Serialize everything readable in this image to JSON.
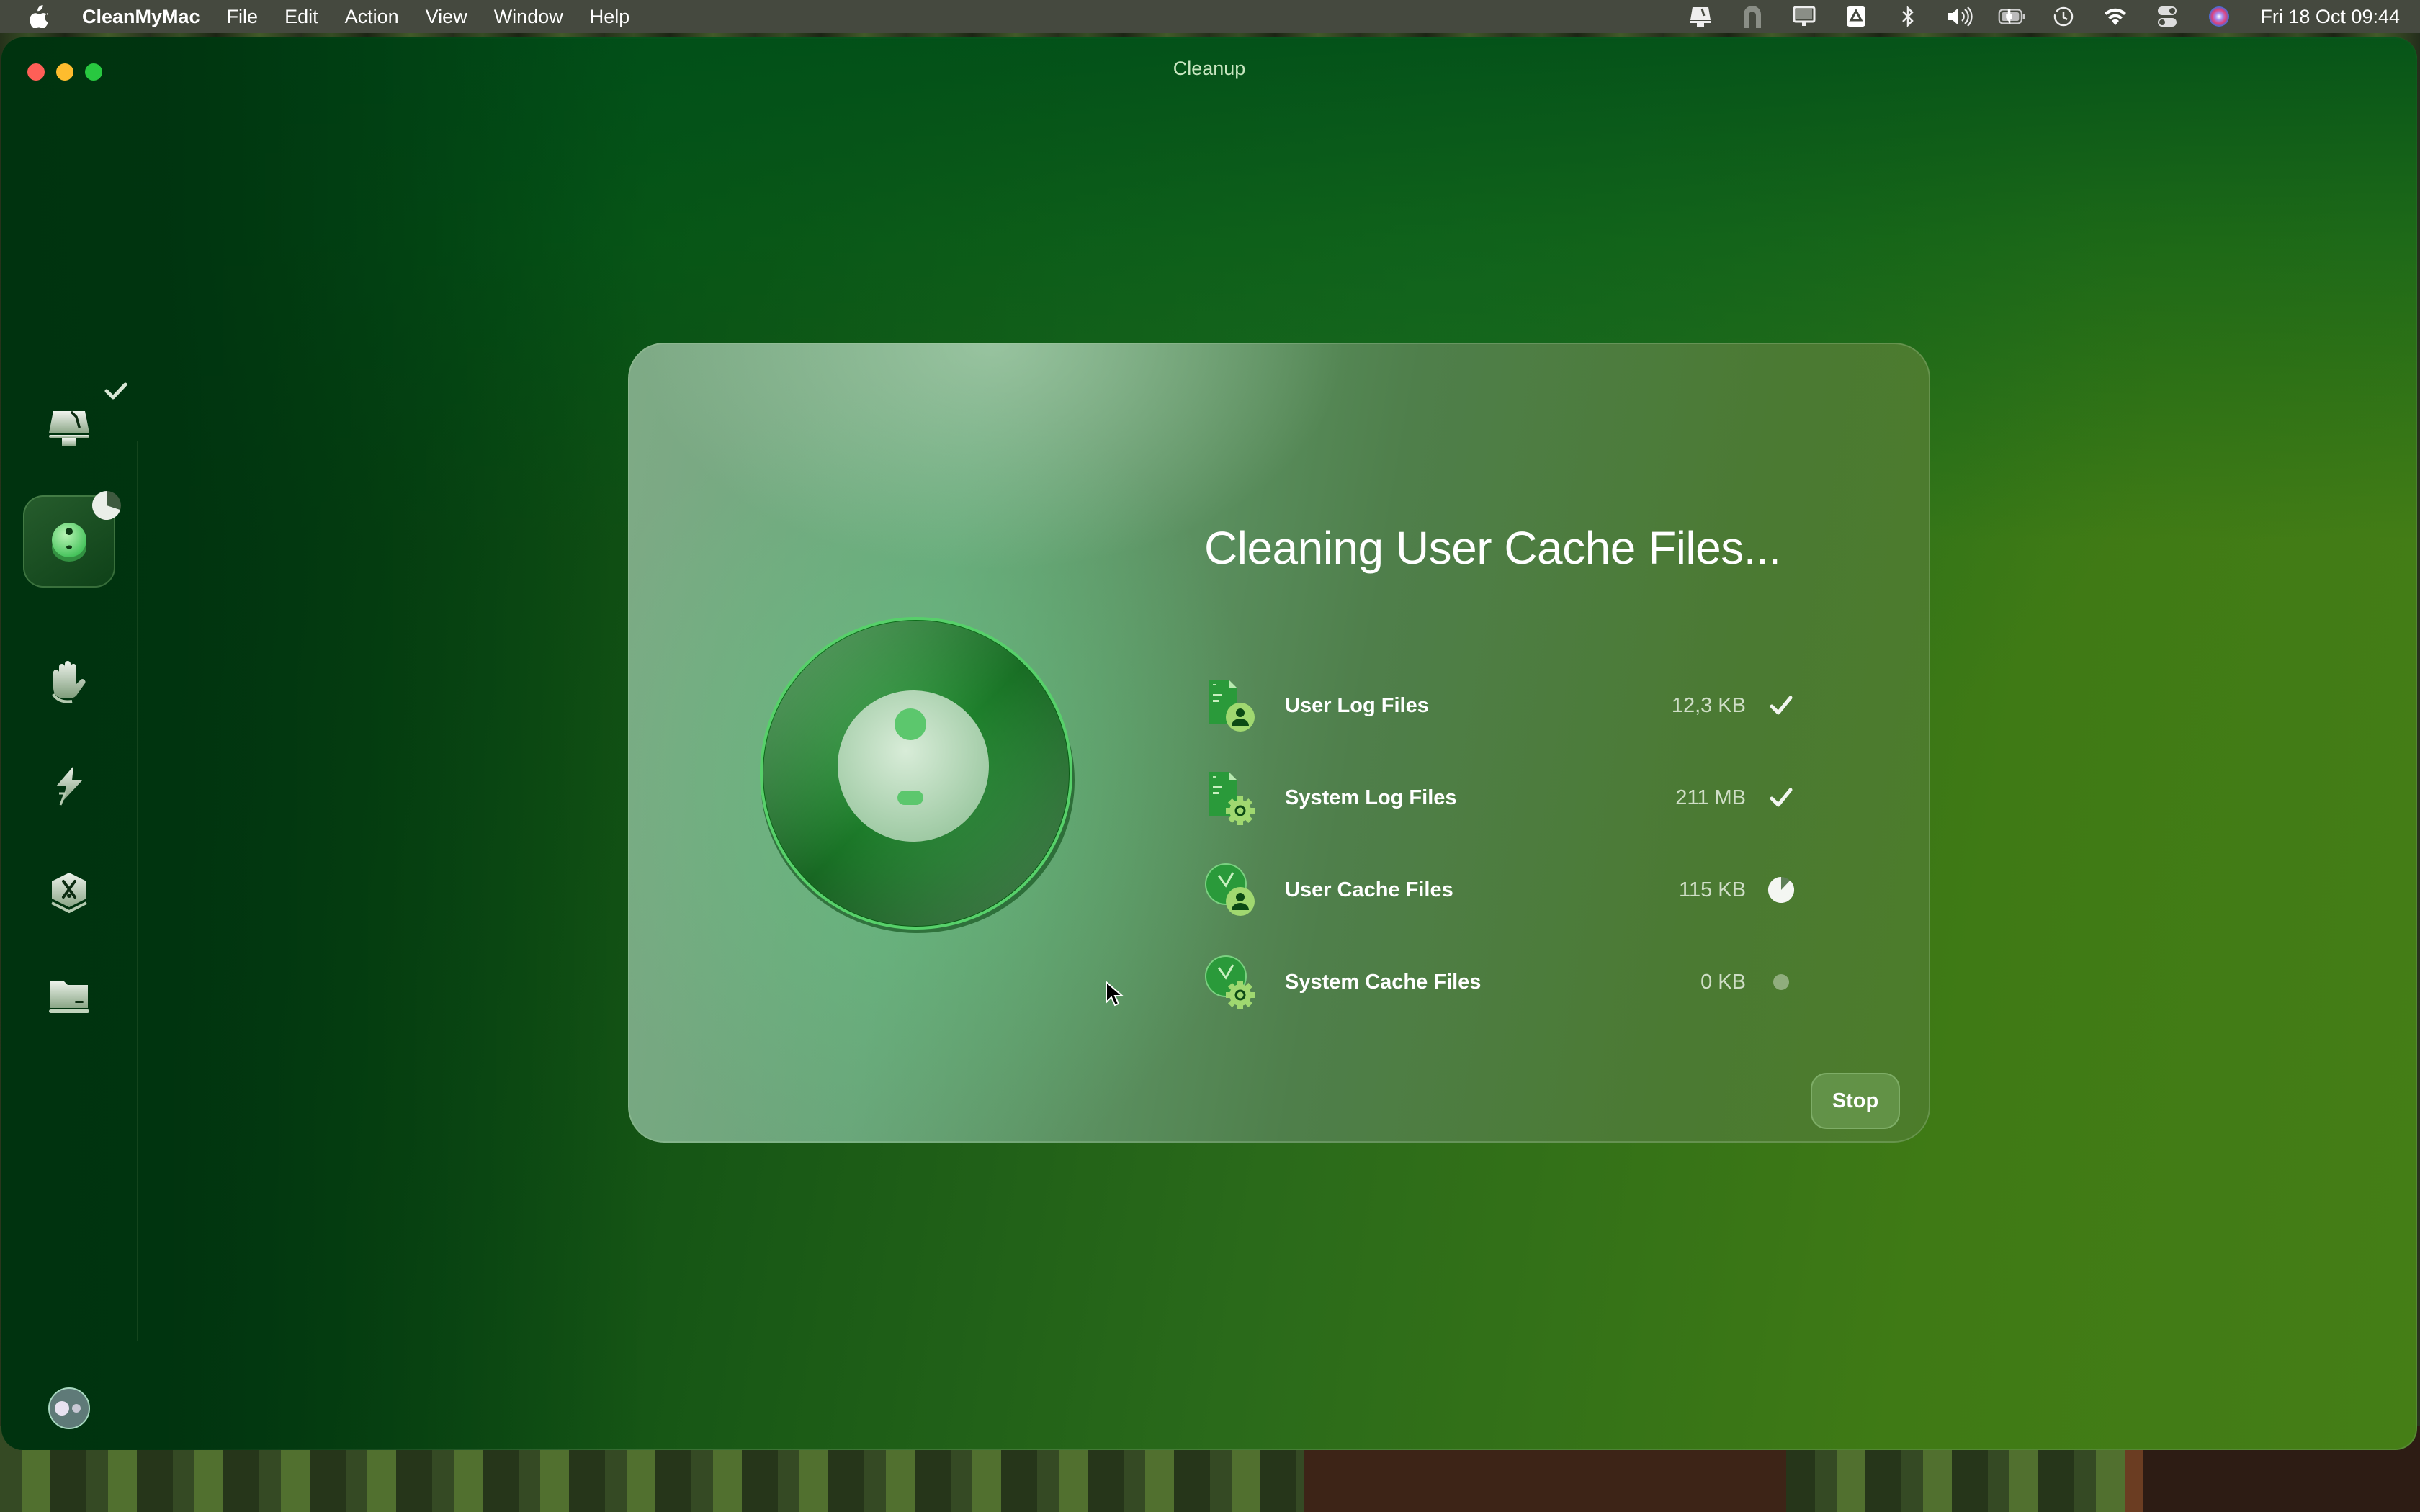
{
  "menubar": {
    "app_name": "CleanMyMac",
    "menus": [
      "File",
      "Edit",
      "Action",
      "View",
      "Window",
      "Help"
    ],
    "status_icons": [
      "cleanmymac-menu-icon",
      "shield-arch-icon",
      "display-icon",
      "google-drive-icon",
      "bluetooth-icon",
      "volume-icon",
      "battery-charging-icon",
      "time-machine-icon",
      "wifi-icon",
      "control-center-icon",
      "siri-icon"
    ],
    "clock": "Fri 18 Oct  09:44"
  },
  "window": {
    "title": "Cleanup"
  },
  "sidebar": {
    "items": [
      {
        "name": "smart-care",
        "icon": "imac-broom-icon",
        "badge": "check",
        "active": false
      },
      {
        "name": "cleanup",
        "icon": "cleanup-orb-icon",
        "badge": "progress",
        "progress": 0.7,
        "active": true
      },
      {
        "name": "protection",
        "icon": "hand-icon",
        "active": false
      },
      {
        "name": "performance",
        "icon": "lightning-icon",
        "active": false
      },
      {
        "name": "applications",
        "icon": "app-tools-icon",
        "active": false
      },
      {
        "name": "my-clutter",
        "icon": "folder-icon",
        "active": false
      }
    ],
    "assistant_icon": "assistant-orb-icon"
  },
  "card": {
    "heading": "Cleaning User Cache Files...",
    "items": [
      {
        "label": "User Log Files",
        "size": "12,3 KB",
        "status": "done",
        "icon": "log-file-user-icon"
      },
      {
        "label": "System Log Files",
        "size": "211 MB",
        "status": "done",
        "icon": "log-file-system-icon"
      },
      {
        "label": "User Cache Files",
        "size": "115 KB",
        "status": "in-progress",
        "progress": 0.88,
        "icon": "cache-clock-user-icon"
      },
      {
        "label": "System Cache Files",
        "size": "0 KB",
        "status": "pending",
        "icon": "cache-clock-system-icon"
      }
    ],
    "stop_label": "Stop"
  },
  "colors": {
    "accent_green": "#4fd068",
    "traffic_red": "#fe5f57",
    "traffic_yellow": "#febc2e",
    "traffic_green": "#28c840"
  }
}
